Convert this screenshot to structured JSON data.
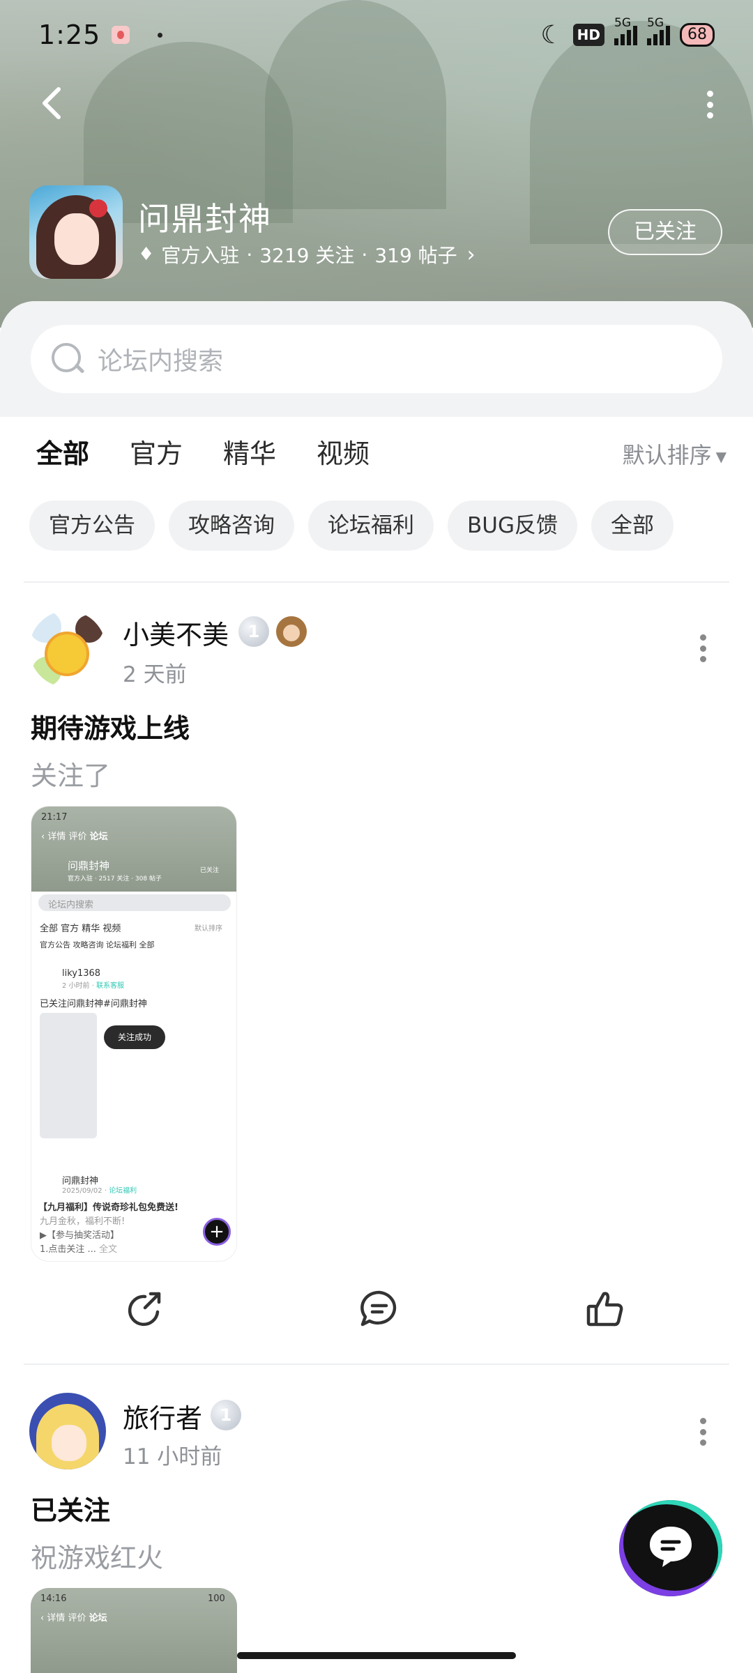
{
  "status_bar": {
    "time": "1:25",
    "hd_label": "HD",
    "sim1_label": "5G",
    "sim2_label": "5G",
    "battery": "68"
  },
  "game": {
    "title": "问鼎封神",
    "meta_official": "官方入驻",
    "meta_followers": "3219 关注",
    "meta_posts": "319 帖子",
    "follow_button": "已关注"
  },
  "search": {
    "placeholder": "论坛内搜索"
  },
  "tabs": [
    {
      "label": "全部",
      "active": true
    },
    {
      "label": "官方"
    },
    {
      "label": "精华"
    },
    {
      "label": "视频"
    }
  ],
  "sort_label": "默认排序",
  "chips": [
    "官方公告",
    "攻略咨询",
    "论坛福利",
    "BUG反馈",
    "全部"
  ],
  "posts": [
    {
      "username": "小美不美",
      "level": "1",
      "time": "2 天前",
      "title": "期待游戏上线",
      "body": "关注了",
      "thumbnail": {
        "time": "21:17",
        "nav_detail": "详情",
        "nav_review": "评价",
        "nav_forum": "论坛",
        "game_title": "问鼎封神",
        "followed": "已关注",
        "meta": "官方入驻 · 2517 关注 · 308 帖子",
        "search": "论坛内搜索",
        "tabs": "全部  官方  精华  视频",
        "sort": "默认排序",
        "chips": "官方公告  攻略咨询  论坛福利  全部",
        "user1": "liky1368",
        "user1_time": "2 小时前",
        "user1_tag": "联系客服",
        "post1_title": "已关注问鼎封神#问鼎封神",
        "toast": "关注成功",
        "user2": "问鼎封神",
        "user2_time": "2025/09/02",
        "user2_tag": "论坛福利",
        "post2_title": "【九月福利】传说奇珍礼包免费送!",
        "post2_line1": "九月金秋，福利不断!",
        "post2_line2": "▶【参与抽奖活动】",
        "post2_line3": "1.点击关注",
        "post2_more": "全文"
      }
    },
    {
      "username": "旅行者",
      "level": "1",
      "time": "11 小时前",
      "title": "已关注",
      "body": "祝游戏红火",
      "thumbnail": {
        "time": "14:16",
        "battery": "100",
        "nav_detail": "详情",
        "nav_review": "评价",
        "nav_forum": "论坛"
      }
    }
  ],
  "colors": {
    "accent": "#2fc9b4",
    "text_primary": "#111111",
    "text_secondary": "#8e9196",
    "chip_bg": "#f1f2f4"
  },
  "icons": {
    "back": "chevron-left-icon",
    "more": "more-vertical-icon",
    "search": "search-icon",
    "share": "share-icon",
    "comment": "comment-icon",
    "like": "thumbs-up-icon",
    "chat": "chat-fab-icon"
  }
}
